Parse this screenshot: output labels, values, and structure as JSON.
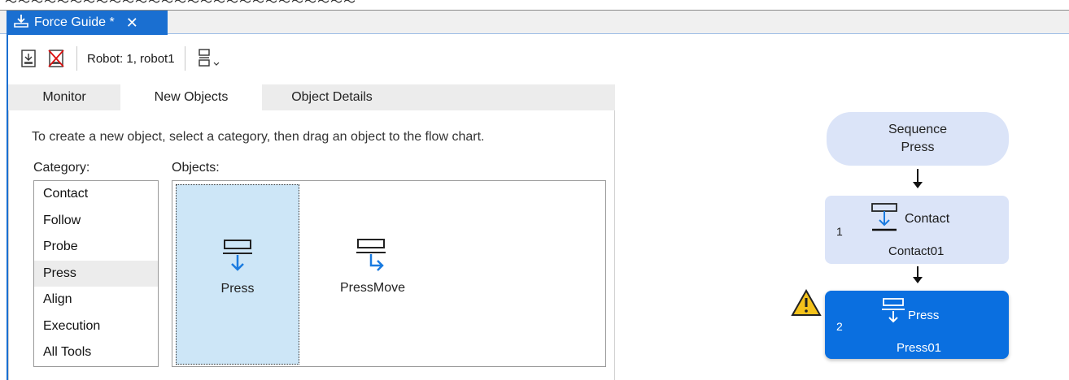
{
  "top_strip_text": "～～～～～～～～～～～～～～～～～～～～～～～～～～～",
  "document_tab": {
    "title": "Force Guide *",
    "close_glyph": "✕"
  },
  "toolbar": {
    "robot_label": "Robot: 1, robot1"
  },
  "tabs": [
    {
      "label": "Monitor",
      "active": false
    },
    {
      "label": "New Objects",
      "active": true
    },
    {
      "label": "Object Details",
      "active": false
    }
  ],
  "new_objects": {
    "instruction": "To create a new object, select a category, then drag an object to the flow chart.",
    "category_label": "Category:",
    "objects_label": "Objects:",
    "categories": [
      "Contact",
      "Follow",
      "Probe",
      "Press",
      "Align",
      "Execution",
      "All Tools"
    ],
    "selected_category": "Press",
    "objects": [
      {
        "name": "Press",
        "icon": "press-icon",
        "selected": true
      },
      {
        "name": "PressMove",
        "icon": "press-move-icon",
        "selected": false
      }
    ]
  },
  "flow": {
    "sequence": {
      "line1": "Sequence",
      "line2": "Press"
    },
    "steps": [
      {
        "number": "1",
        "type": "Contact",
        "name": "Contact01",
        "icon": "contact-icon",
        "warning": false
      },
      {
        "number": "2",
        "type": "Press",
        "name": "Press01",
        "icon": "press-icon",
        "warning": true
      }
    ]
  },
  "colors": {
    "accent": "#1a6fd1",
    "selected_step": "#0a6fe0",
    "flow_box": "#dbe4f8",
    "selected_object": "#cde6f7"
  }
}
